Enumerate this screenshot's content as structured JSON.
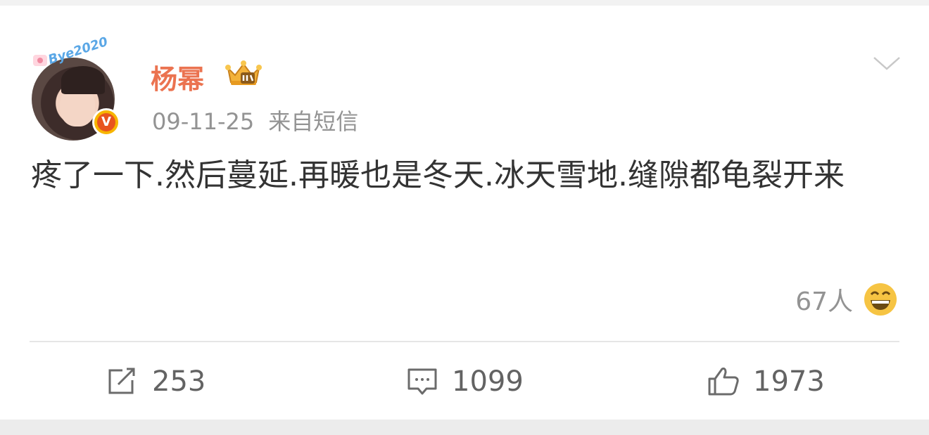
{
  "post": {
    "author": "杨幂",
    "avatar_badge_text": "Bye2020",
    "verified_mark": "V",
    "vip_icon": "vip-crown-icon",
    "date": "09-11-25",
    "source": "来自短信",
    "text": "疼了一下.然后蔓延.再暖也是冬天.冰天雪地.缝隙都龟裂开来",
    "reaction_count": "67人",
    "reaction_icon": "grinning-face-emoji"
  },
  "actions": {
    "repost_count": "253",
    "comment_count": "1099",
    "like_count": "1973"
  },
  "colors": {
    "author_name": "#eb7350",
    "meta_text": "#939393",
    "body_text": "#333333",
    "badge_gold": "#f7b500",
    "badge_red": "#e8541e"
  }
}
